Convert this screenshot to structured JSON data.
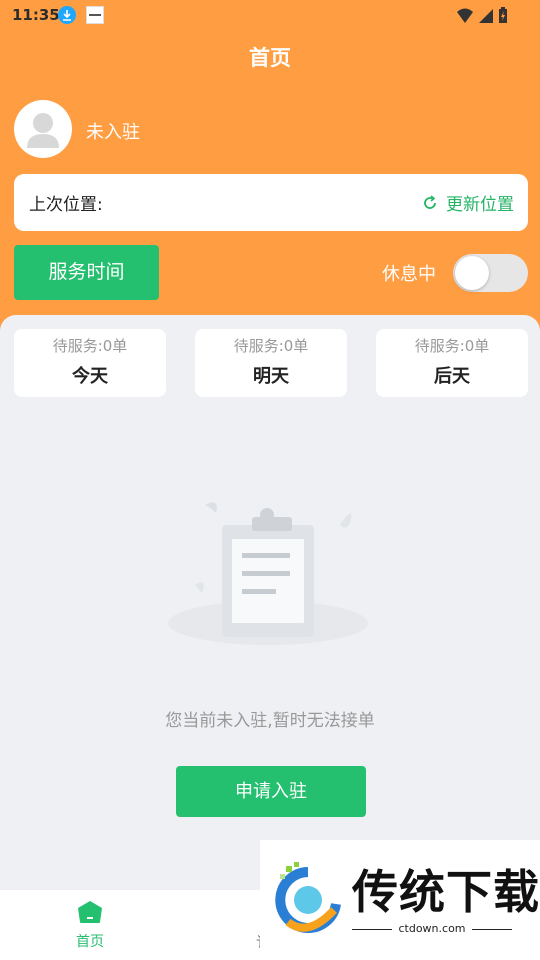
{
  "status_bar": {
    "time": "11:35",
    "icons": [
      "download-icon",
      "app-notification-icon",
      "wifi-icon",
      "signal-icon",
      "battery-icon"
    ]
  },
  "header": {
    "title": "首页"
  },
  "user": {
    "name": "未入驻",
    "avatar_icon": "user-avatar-icon"
  },
  "location": {
    "label": "上次位置:",
    "update_label": "更新位置",
    "update_icon": "refresh-icon"
  },
  "controls": {
    "service_time_label": "服务时间",
    "rest_label": "休息中",
    "rest_toggle_on": false
  },
  "days": [
    {
      "pending": "待服务:0单",
      "name": "今天"
    },
    {
      "pending": "待服务:0单",
      "name": "明天"
    },
    {
      "pending": "待服务:0单",
      "name": "后天"
    }
  ],
  "empty_state": {
    "icon": "clipboard-icon",
    "message": "您当前未入驻,暂时无法接单",
    "apply_label": "申请入驻"
  },
  "tabbar": {
    "home_label": "首页",
    "second_label_partial": "讠"
  },
  "watermark": {
    "brand": "传统下载",
    "site": "ctdown.com"
  },
  "colors": {
    "header_bg": "#ff9d42",
    "accent_green": "#25bf70",
    "page_bg": "#eef0f3"
  }
}
